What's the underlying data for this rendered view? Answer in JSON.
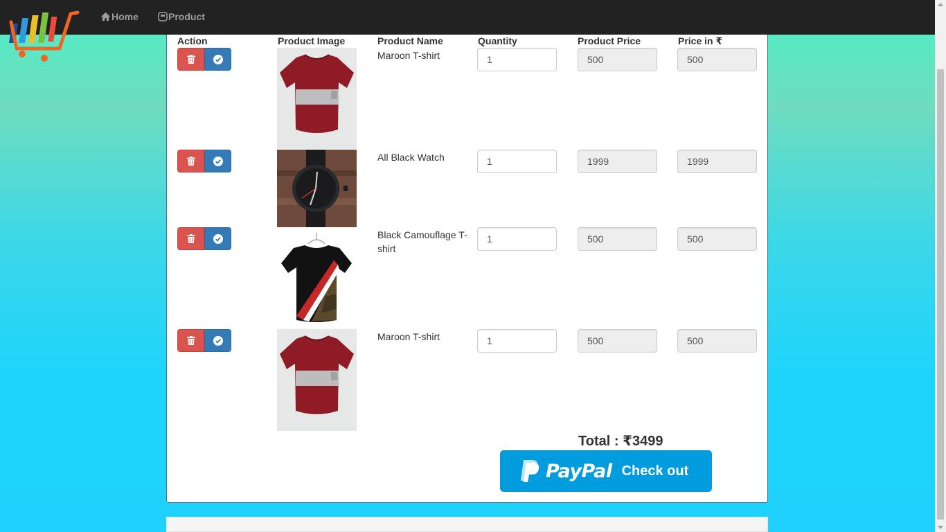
{
  "nav": {
    "home_label": "Home",
    "product_label": "Product"
  },
  "table": {
    "headers": [
      "Action",
      "Product Image",
      "Product Name",
      "Quantity",
      "Product Price",
      "Price in ₹"
    ],
    "rows": [
      {
        "name": "Maroon T-shirt",
        "quantity": "1",
        "price": "500",
        "price_inr": "500",
        "image": "maroon-tshirt"
      },
      {
        "name": "All Black Watch",
        "quantity": "1",
        "price": "1999",
        "price_inr": "1999",
        "image": "black-watch"
      },
      {
        "name": "Black Camouflage T-shirt",
        "quantity": "1",
        "price": "500",
        "price_inr": "500",
        "image": "black-camouflage-tshirt"
      },
      {
        "name": "Maroon T-shirt",
        "quantity": "1",
        "price": "500",
        "price_inr": "500",
        "image": "maroon-tshirt"
      }
    ]
  },
  "total_label": "Total : ₹3499",
  "paypal": {
    "brand": "PayPal",
    "label": "Check out"
  },
  "colors": {
    "navbar": "#222222",
    "danger": "#d9534f",
    "primary": "#337ab7",
    "paypal": "#009cde"
  },
  "icons": [
    "cart-logo",
    "home-icon",
    "product-icon",
    "trash-icon",
    "check-circle-icon",
    "paypal-p-icon"
  ]
}
